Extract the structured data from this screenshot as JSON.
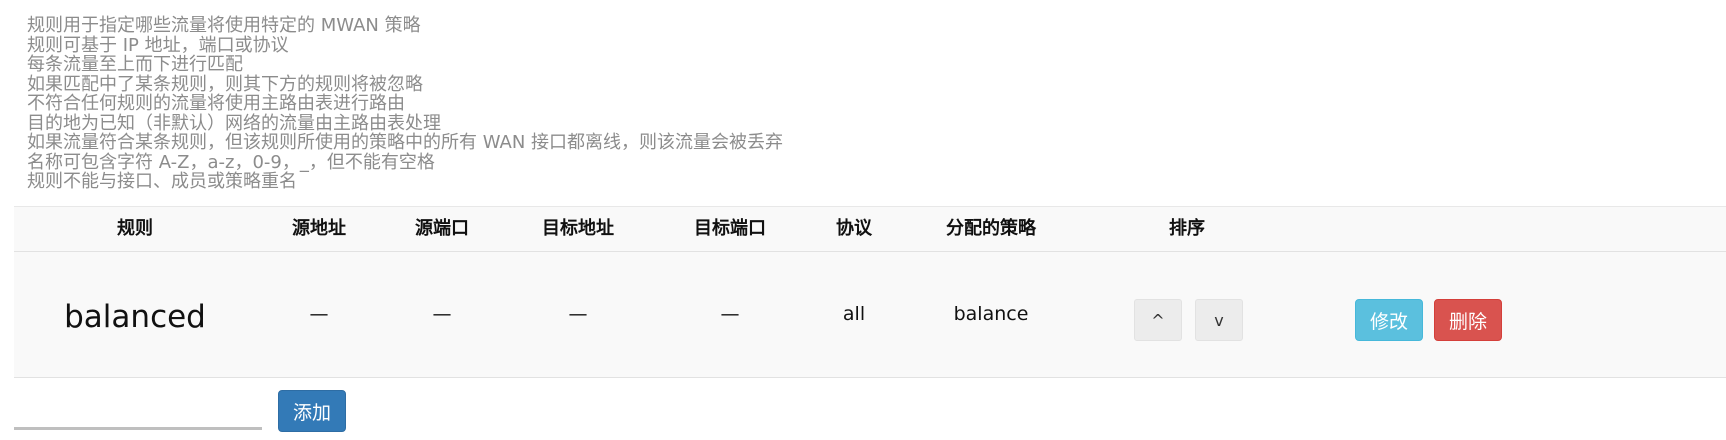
{
  "description": [
    "规则用于指定哪些流量将使用特定的 MWAN 策略",
    "规则可基于 IP 地址，端口或协议",
    "每条流量至上而下进行匹配",
    "如果匹配中了某条规则，则其下方的规则将被忽略",
    "不符合任何规则的流量将使用主路由表进行路由",
    "目的地为已知（非默认）网络的流量由主路由表处理",
    "如果流量符合某条规则，但该规则所使用的策略中的所有 WAN 接口都离线，则该流量会被丢弃",
    "名称可包含字符 A-Z，a-z，0-9，_，但不能有空格",
    "规则不能与接口、成员或策略重名"
  ],
  "table": {
    "headers": [
      "规则",
      "源地址",
      "源端口",
      "目标地址",
      "目标端口",
      "协议",
      "分配的策略",
      "排序"
    ],
    "rows": [
      {
        "name": "balanced",
        "src_ip": "—",
        "src_port": "—",
        "dest_ip": "—",
        "dest_port": "—",
        "proto": "all",
        "policy": "balance"
      }
    ]
  },
  "icons": {
    "up": "^",
    "down": "v"
  },
  "buttons": {
    "edit": "修改",
    "delete": "删除",
    "add": "添加"
  },
  "add_input": {
    "value": "",
    "placeholder": ""
  }
}
